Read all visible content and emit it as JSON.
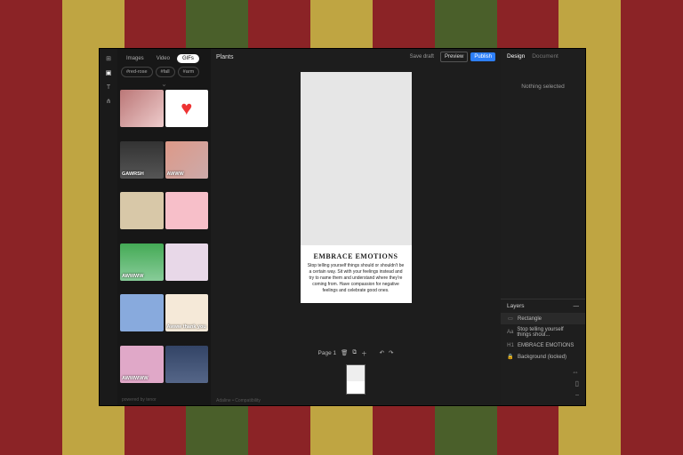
{
  "doc_title": "Plants",
  "top": {
    "save": "Save draft",
    "preview": "Preview",
    "publish": "Publish"
  },
  "rail": {
    "tabs": [
      "Images",
      "Video",
      "GIFs"
    ],
    "active": 2,
    "tags": [
      "#red-rose",
      "#fall",
      "#arm"
    ],
    "attribution": "powered by tenor"
  },
  "gifs": [
    {
      "label": ""
    },
    {
      "label": ""
    },
    {
      "label": "GAWRSH"
    },
    {
      "label": "AWWW"
    },
    {
      "label": ""
    },
    {
      "label": ""
    },
    {
      "label": "AWWWW"
    },
    {
      "label": ""
    },
    {
      "label": ""
    },
    {
      "label": "Awww thank you"
    },
    {
      "label": "AWWWWW"
    },
    {
      "label": ""
    }
  ],
  "page": {
    "heading": "EMBRACE EMOTIONS",
    "body": "Stop telling yourself things should or shouldn't be a certain way. Sit with your feelings instead and try to name them and understand where they're coming from. Have compassion for negative feelings and celebrate good ones."
  },
  "page_tools": {
    "label": "Page 1"
  },
  "footer": "Adaline • Compatibility",
  "right": {
    "tabs": [
      "Design",
      "Document"
    ],
    "active": 0,
    "empty": "Nothing selected",
    "layers_title": "Layers",
    "layers": [
      {
        "icon": "▭",
        "name": "Rectangle",
        "sel": true
      },
      {
        "icon": "Aa",
        "name": "Stop telling yourself things shoul..."
      },
      {
        "icon": "H1",
        "name": "EMBRACE EMOTIONS"
      },
      {
        "icon": "🔒",
        "name": "Background (locked)"
      }
    ]
  }
}
